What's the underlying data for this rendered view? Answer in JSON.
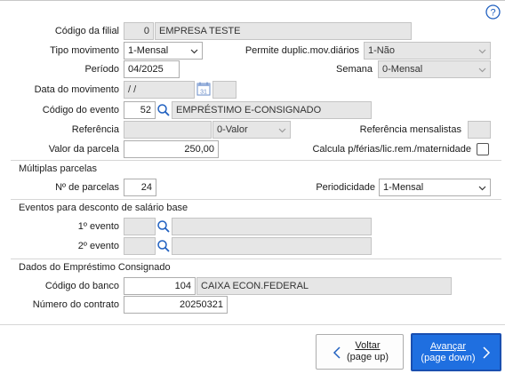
{
  "help": {
    "icon": "help-icon",
    "glyph": "?"
  },
  "filial": {
    "label": "Código da filial",
    "code": "0",
    "name": "EMPRESA TESTE"
  },
  "tipo_movimento": {
    "label": "Tipo movimento",
    "value": "1-Mensal"
  },
  "permite_duplic": {
    "label": "Permite duplic.mov.diários",
    "value": "1-Não"
  },
  "periodo": {
    "label": "Período",
    "value": "04/2025"
  },
  "semana": {
    "label": "Semana",
    "value": "0-Mensal"
  },
  "data_movimento": {
    "label": "Data do movimento",
    "value": " /  /",
    "calendar_icon": "calendar-icon",
    "calendar_day": "31"
  },
  "codigo_evento": {
    "label": "Código do evento",
    "code": "52",
    "name": "EMPRÉSTIMO E-CONSIGNADO"
  },
  "referencia": {
    "label": "Referência",
    "value": "",
    "type": "0-Valor"
  },
  "referencia_mensalistas": {
    "label": "Referência mensalistas"
  },
  "valor_parcela": {
    "label": "Valor da parcela",
    "value": "250,00"
  },
  "calcula": {
    "label": "Calcula p/férias/lic.rem./maternidade",
    "checked": false
  },
  "multiplas": {
    "section_label": "Múltiplas parcelas",
    "n_parcelas_label": "Nº de parcelas",
    "n_parcelas": "24",
    "periodicidade_label": "Periodicidade",
    "periodicidade": "1-Mensal"
  },
  "eventos_desconto": {
    "section_label": "Eventos para desconto de salário base",
    "evento1_label": "1º evento",
    "evento2_label": "2º evento"
  },
  "emprestimo": {
    "section_label": "Dados do Empréstimo Consignado",
    "banco_label": "Código do banco",
    "banco_code": "104",
    "banco_name": "CAIXA ECON.FEDERAL",
    "contrato_label": "Número do contrato",
    "contrato": "20250321"
  },
  "buttons": {
    "back_line1": "Voltar",
    "back_line2": "(page up)",
    "next_line1": "Avançar",
    "next_line2": "(page down)"
  },
  "colors": {
    "accent": "#1f6fe0",
    "icon_blue": "#2060c0"
  }
}
